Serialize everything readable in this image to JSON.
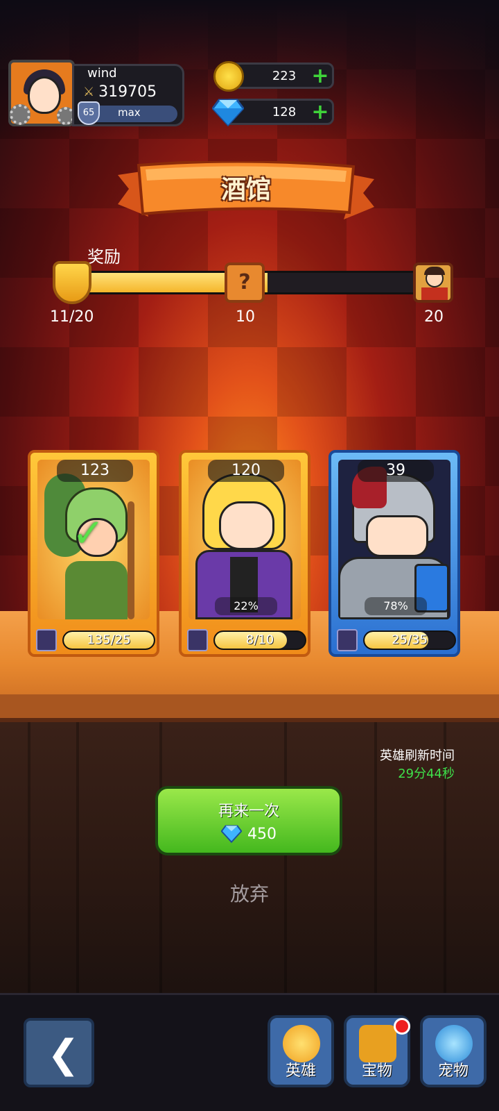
{
  "player": {
    "name": "wind",
    "power": "319705",
    "level": "65",
    "level_status": "max"
  },
  "currencies": {
    "gold": "223",
    "gems": "128"
  },
  "banner": {
    "title": "酒馆"
  },
  "reward": {
    "label": "奖励",
    "progress_text": "11/20",
    "progress_fraction": 0.55,
    "milestones": [
      "10",
      "20"
    ]
  },
  "cards": [
    {
      "power": "123",
      "fragments": "135/25",
      "fragment_fraction": 1.0,
      "rarity": "gold",
      "owned_check": true
    },
    {
      "power": "120",
      "percent": "22%",
      "fragments": "8/10",
      "fragment_fraction": 0.8,
      "rarity": "gold"
    },
    {
      "power": "39",
      "percent": "78%",
      "fragments": "25/35",
      "fragment_fraction": 0.71,
      "rarity": "blue"
    }
  ],
  "refresh": {
    "label": "英雄刷新时间",
    "time": "29分44秒"
  },
  "actions": {
    "again_label": "再来一次",
    "again_cost": "450",
    "abandon_label": "放弃"
  },
  "nav": {
    "tabs": [
      {
        "label": "英雄"
      },
      {
        "label": "宝物"
      },
      {
        "label": "宠物"
      }
    ]
  },
  "colors": {
    "accent_green": "#44b81e",
    "gold": "#f5b62b",
    "refresh_time": "#3fe04a"
  }
}
